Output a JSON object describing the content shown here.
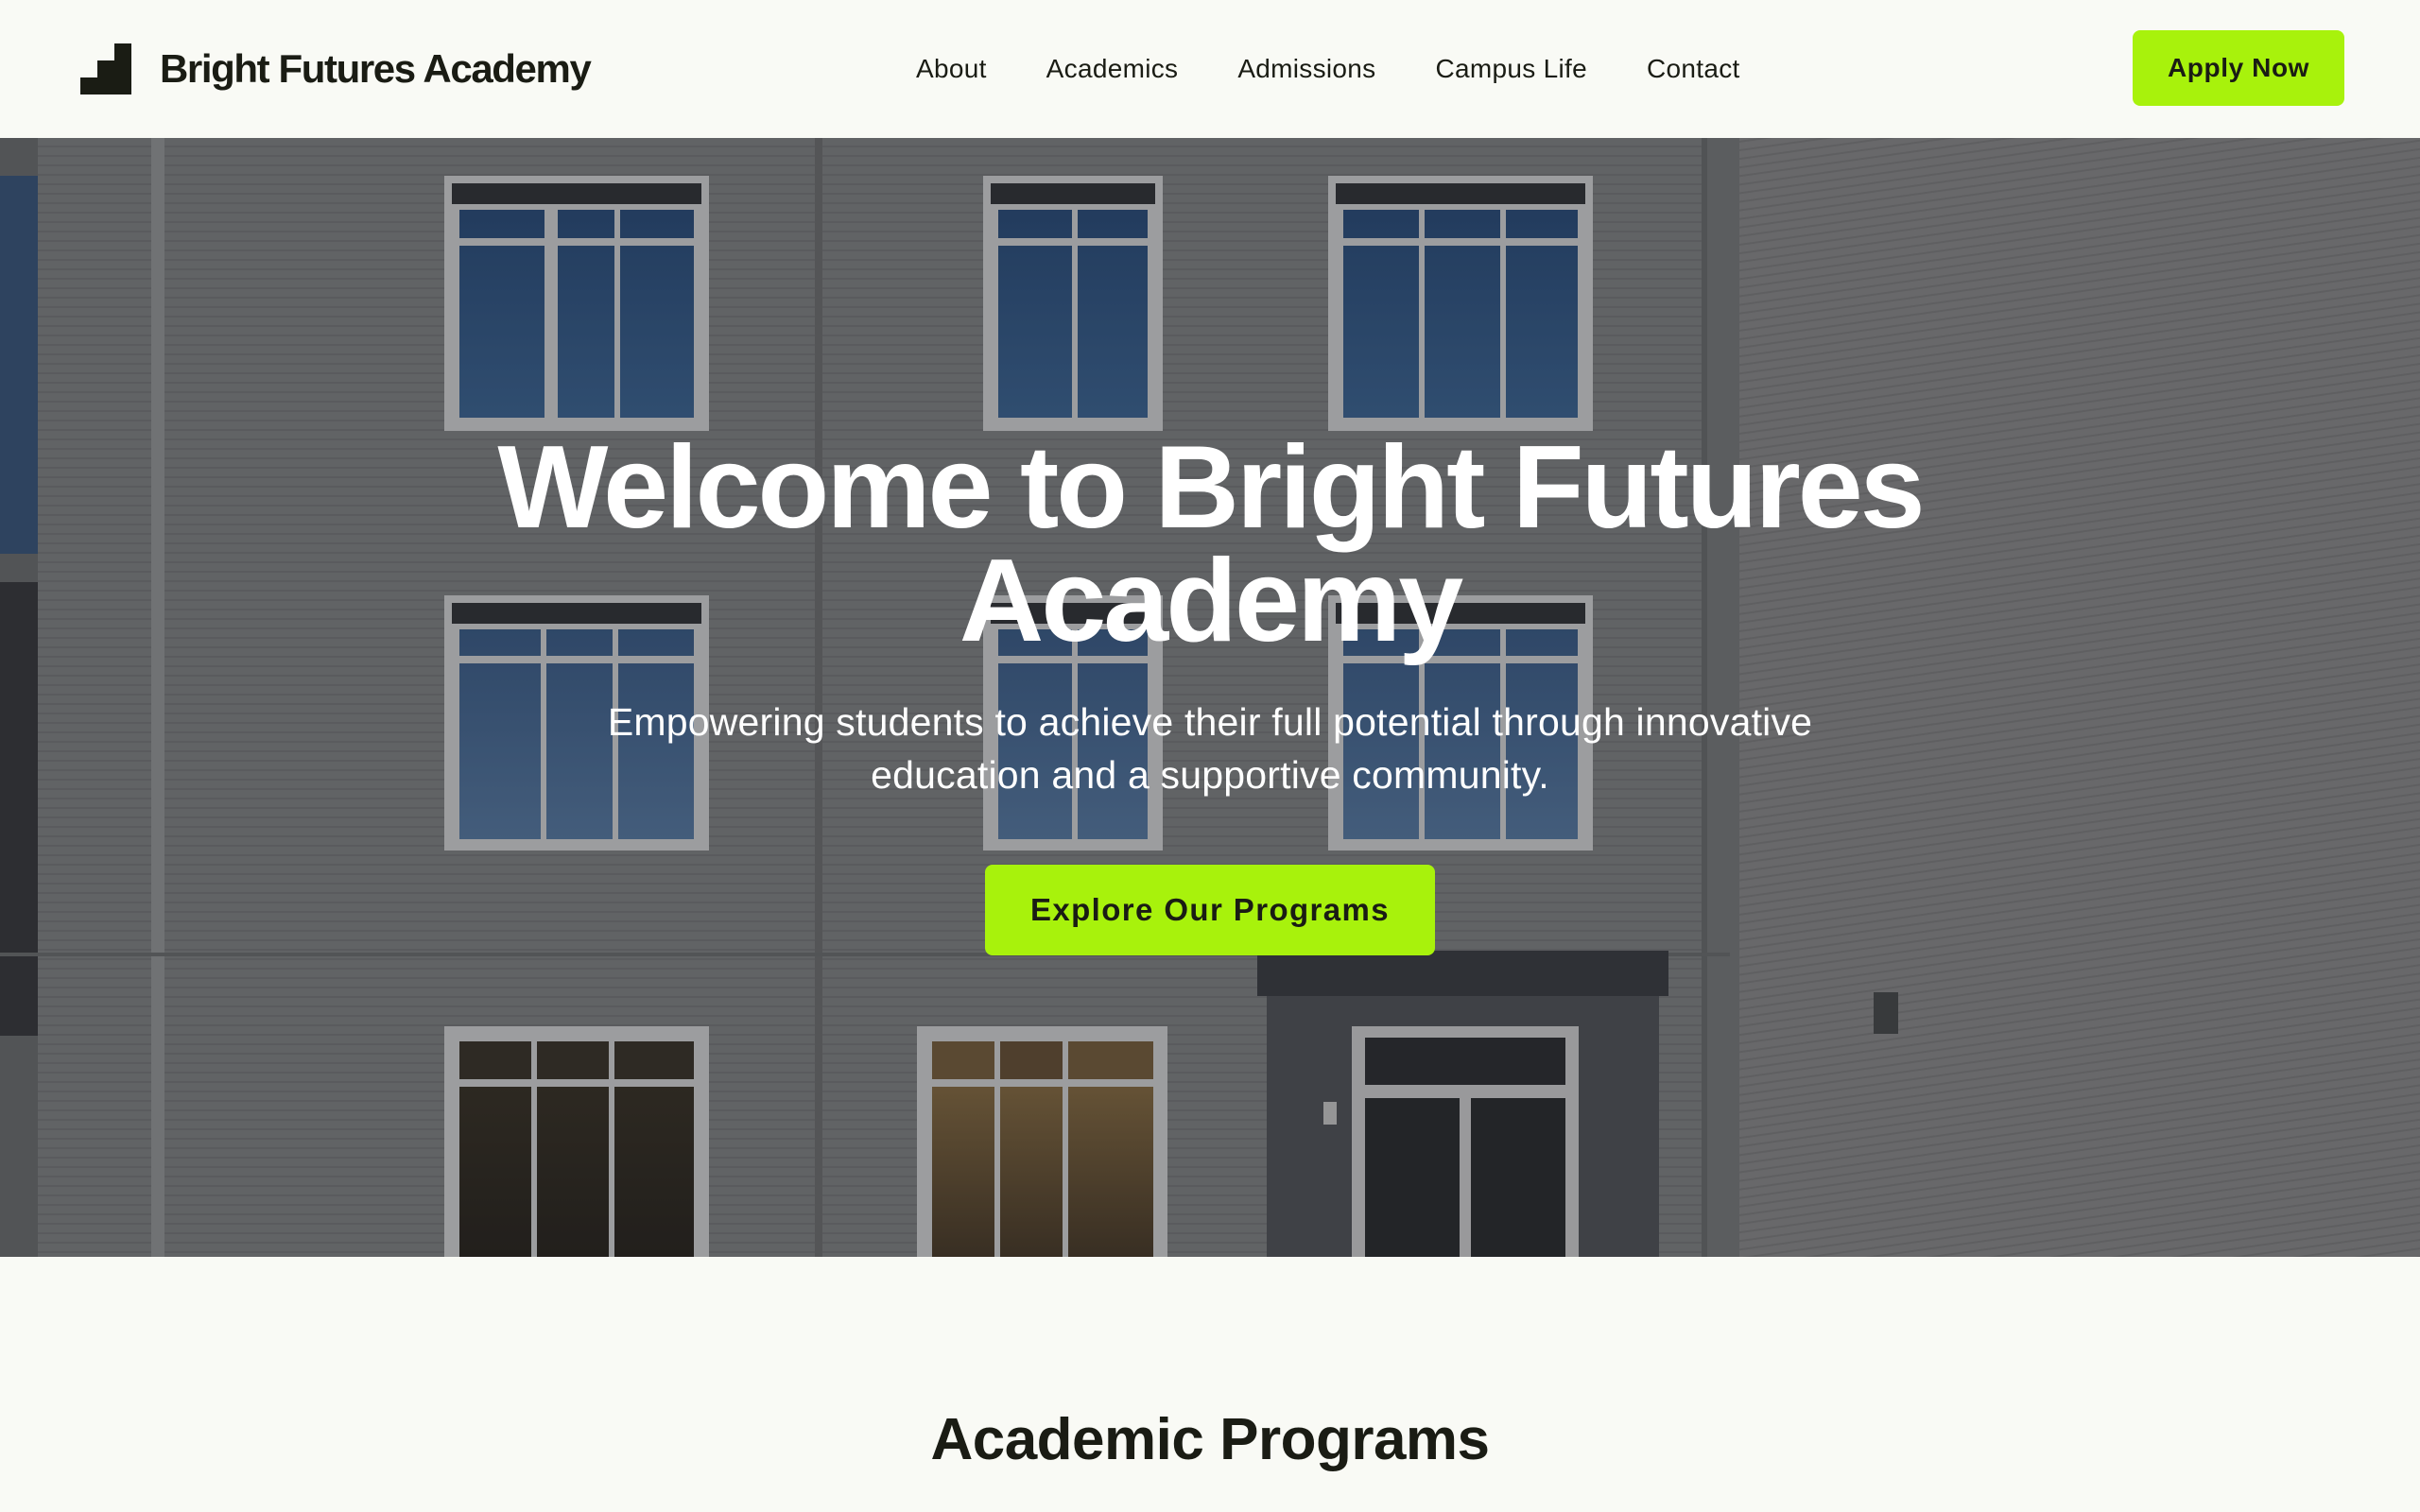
{
  "header": {
    "brand_name": "Bright Futures Academy",
    "logo_icon": "stairs-logo-icon",
    "nav": [
      {
        "label": "About"
      },
      {
        "label": "Academics"
      },
      {
        "label": "Admissions"
      },
      {
        "label": "Campus Life"
      },
      {
        "label": "Contact"
      }
    ],
    "apply_label": "Apply Now"
  },
  "hero": {
    "title": "Welcome to Bright Futures Academy",
    "subtitle": "Empowering students to achieve their full potential through innovative education and a supportive community.",
    "cta_label": "Explore Our Programs",
    "background_image": "school building facade"
  },
  "programs": {
    "title": "Academic Programs"
  },
  "colors": {
    "accent": "#a8f20c",
    "text_dark": "#1a1c14",
    "page_bg": "#f9faf5",
    "hero_text": "#ffffff"
  }
}
